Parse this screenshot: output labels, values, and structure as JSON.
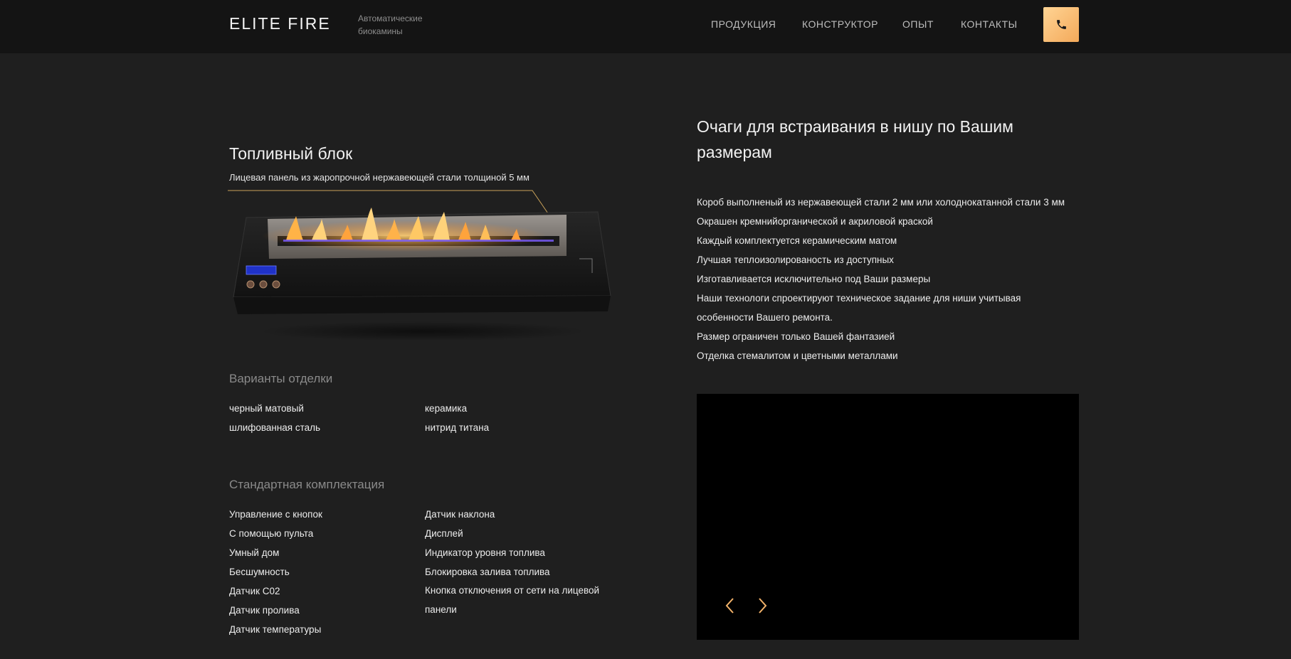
{
  "brand": {
    "name": "ELITE FIRE",
    "tagline": "Автоматические биокамины"
  },
  "nav": [
    "ПРОДУКЦИЯ",
    "КОНСТРУКТОР",
    "ОПЫТ",
    "КОНТАКТЫ"
  ],
  "phone_icon": "phone-icon",
  "fuel_block": {
    "title": "Топливный блок",
    "caption": "Лицевая панель из жаропрочной нержавеющей стали толщиной 5 мм"
  },
  "finishes": {
    "title": "Варианты отделки",
    "items": [
      "черный матовый",
      "керамика",
      "шлифованная сталь",
      "нитрид титана"
    ]
  },
  "equipment": {
    "title": "Стандартная комплектация",
    "col1": [
      "Управление с кнопок",
      "С помощью пульта",
      "Умный дом",
      "Бесшумность",
      "Датчик С02",
      "Датчик пролива",
      "Датчик температуры"
    ],
    "col2": [
      "Датчик наклона",
      "Дисплей",
      "Индикатор уровня топлива",
      "Блокировка залива топлива",
      "Кнопка отключения от сети на лицевой панели"
    ]
  },
  "niche": {
    "title": "Очаги для встраивания в нишу по Вашим размерам",
    "features": [
      "Короб выполненый из нержавеющей стали 2 мм или холоднокатанной стали 3 мм",
      "Окрашен кремнийорганической и акриловой краской",
      "Каждый комплектуется керамическим матом",
      "Лучшая теплоизолированость из доступных",
      "Изготавливается исключительно под Ваши размеры",
      "Наши технологи спроектируют техническое задание для ниши учитывая",
      "особенности Вашего ремонта.",
      "Размер ограничен только Вашей фантазией",
      "Отделка стемалитом и цветными металлами"
    ]
  },
  "colors": {
    "background": "#1f1f1f",
    "header": "#141414",
    "accent": "#f3b36a",
    "video": "#000000"
  }
}
